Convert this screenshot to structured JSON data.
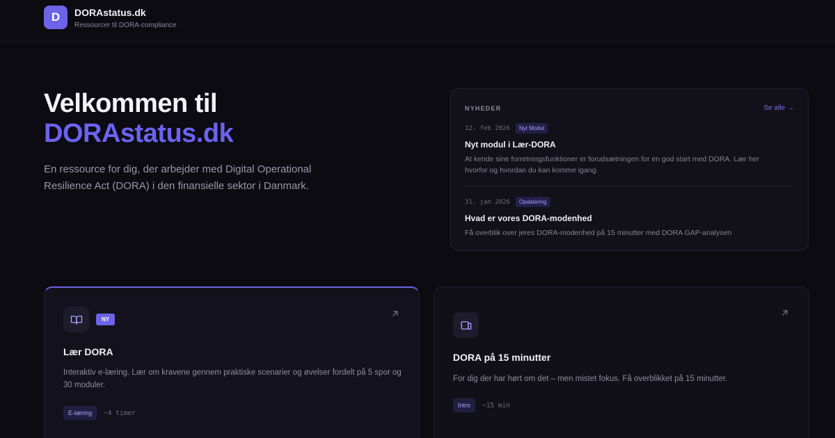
{
  "header": {
    "logo_letter": "D",
    "brand_name": "DORAstatus.dk",
    "tagline": "Ressourcer til DORA-compliance"
  },
  "hero": {
    "title_line1": "Velkommen til",
    "title_line2": "DORAstatus.dk",
    "subtitle": "En ressource for dig, der arbejder med Digital Operational Resilience Act (DORA) i den finansielle sektor i Danmark."
  },
  "news": {
    "label": "NYHEDER",
    "see_all": "Se alle →",
    "items": [
      {
        "date": "12. feb 2026",
        "tag": "Nyt Modul",
        "title": "Nyt modul i Lær-DORA",
        "desc": "At kende sine forretningsfunktioner er forudsætningen for en god start med DORA. Lær her hvorfor og hvordan du kan komme igang."
      },
      {
        "date": "31. jan 2026",
        "tag": "Opdatering",
        "title": "Hvad er vores DORA-modenhed",
        "desc": "Få overblik over jeres DORA-modenhed på 15 minutter med DORA GAP-analysen"
      }
    ]
  },
  "cards": [
    {
      "badge": "NY",
      "title": "Lær DORA",
      "desc": "Interaktiv e-læring. Lær om kravene gennem praktiske scenarier og øvelser fordelt på 5 spor og 30 moduler.",
      "chip": "E-læring",
      "duration": "~4 timer",
      "icon": "book-icon"
    },
    {
      "title": "DORA på 15 minutter",
      "desc": "For dig der har hørt om det – men mistet fokus. Få overblikket på 15 minutter.",
      "chip": "Intro",
      "duration": "~15 min",
      "icon": "slides-icon"
    }
  ],
  "colors": {
    "accent": "#6b63f0",
    "background": "#0c0b11"
  }
}
